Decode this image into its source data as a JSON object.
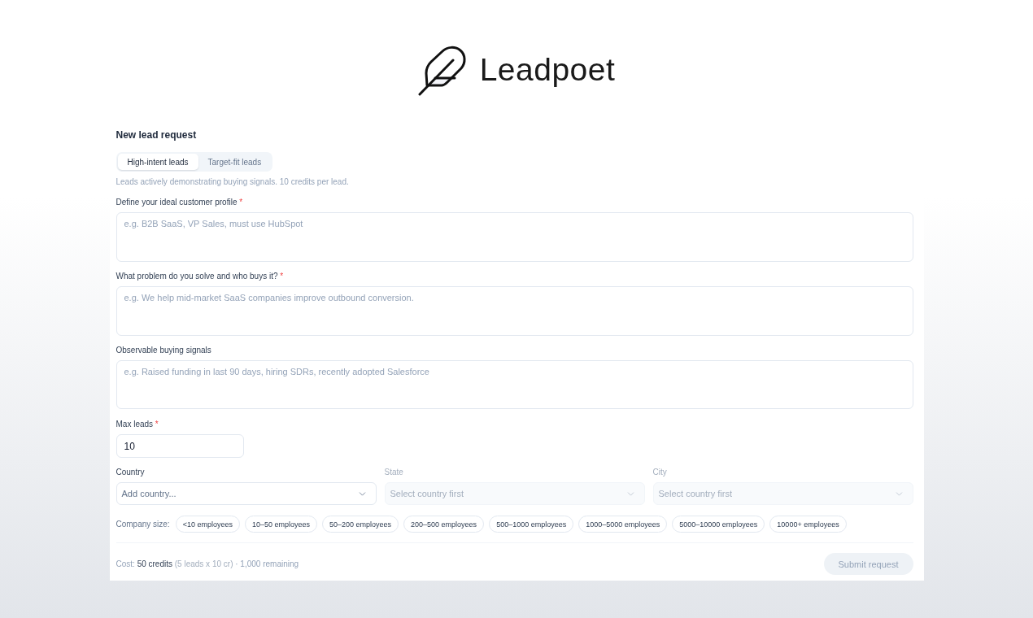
{
  "logo": {
    "name": "Leadpoet"
  },
  "form": {
    "title": "New lead request",
    "tabs": [
      {
        "label": "High-intent leads",
        "selected": true
      },
      {
        "label": "Target-fit leads",
        "selected": false
      }
    ],
    "description": "Leads actively demonstrating buying signals. 10 credits per lead.",
    "text_fields": [
      {
        "label": "Define your ideal customer profile",
        "required_mark": "*",
        "placeholder": "e.g. B2B SaaS, VP Sales, must use HubSpot"
      },
      {
        "label": "What problem do you solve and who buys it?",
        "required_mark": "*",
        "placeholder": "e.g. We help mid-market SaaS companies improve outbound conversion."
      },
      {
        "label": "Observable buying signals",
        "placeholder": "e.g. Raised funding in last 90 days, hiring SDRs, recently adopted Salesforce"
      }
    ],
    "max_leads": {
      "label": "Max leads",
      "required_mark": "*",
      "value": "10"
    },
    "location": [
      {
        "label": "Country",
        "placeholder": "Add country...",
        "disabled": false
      },
      {
        "label": "State",
        "placeholder": "Select country first",
        "disabled": true
      },
      {
        "label": "City",
        "placeholder": "Select country first",
        "disabled": true
      }
    ],
    "company_size": {
      "label": "Company size:",
      "options": [
        {
          "label": "<10 employees",
          "selected": false
        },
        {
          "label": "10–50 employees",
          "selected": false
        },
        {
          "label": "50–200 employees",
          "selected": false
        },
        {
          "label": "200–500 employees",
          "selected": false
        },
        {
          "label": "500–1000 employees",
          "selected": false
        },
        {
          "label": "1000–5000 employees",
          "selected": false
        },
        {
          "label": "5000–10000 employees",
          "selected": false
        },
        {
          "label": "10000+ employees",
          "selected": false
        }
      ]
    },
    "footer": {
      "cost": {
        "label": "Cost:",
        "amount": "50 credits",
        "breakdown": "(5 leads x 10 cr)",
        "remaining": "· 1,000 remaining"
      },
      "submit": {
        "label": "Submit request",
        "disabled": true
      }
    }
  }
}
